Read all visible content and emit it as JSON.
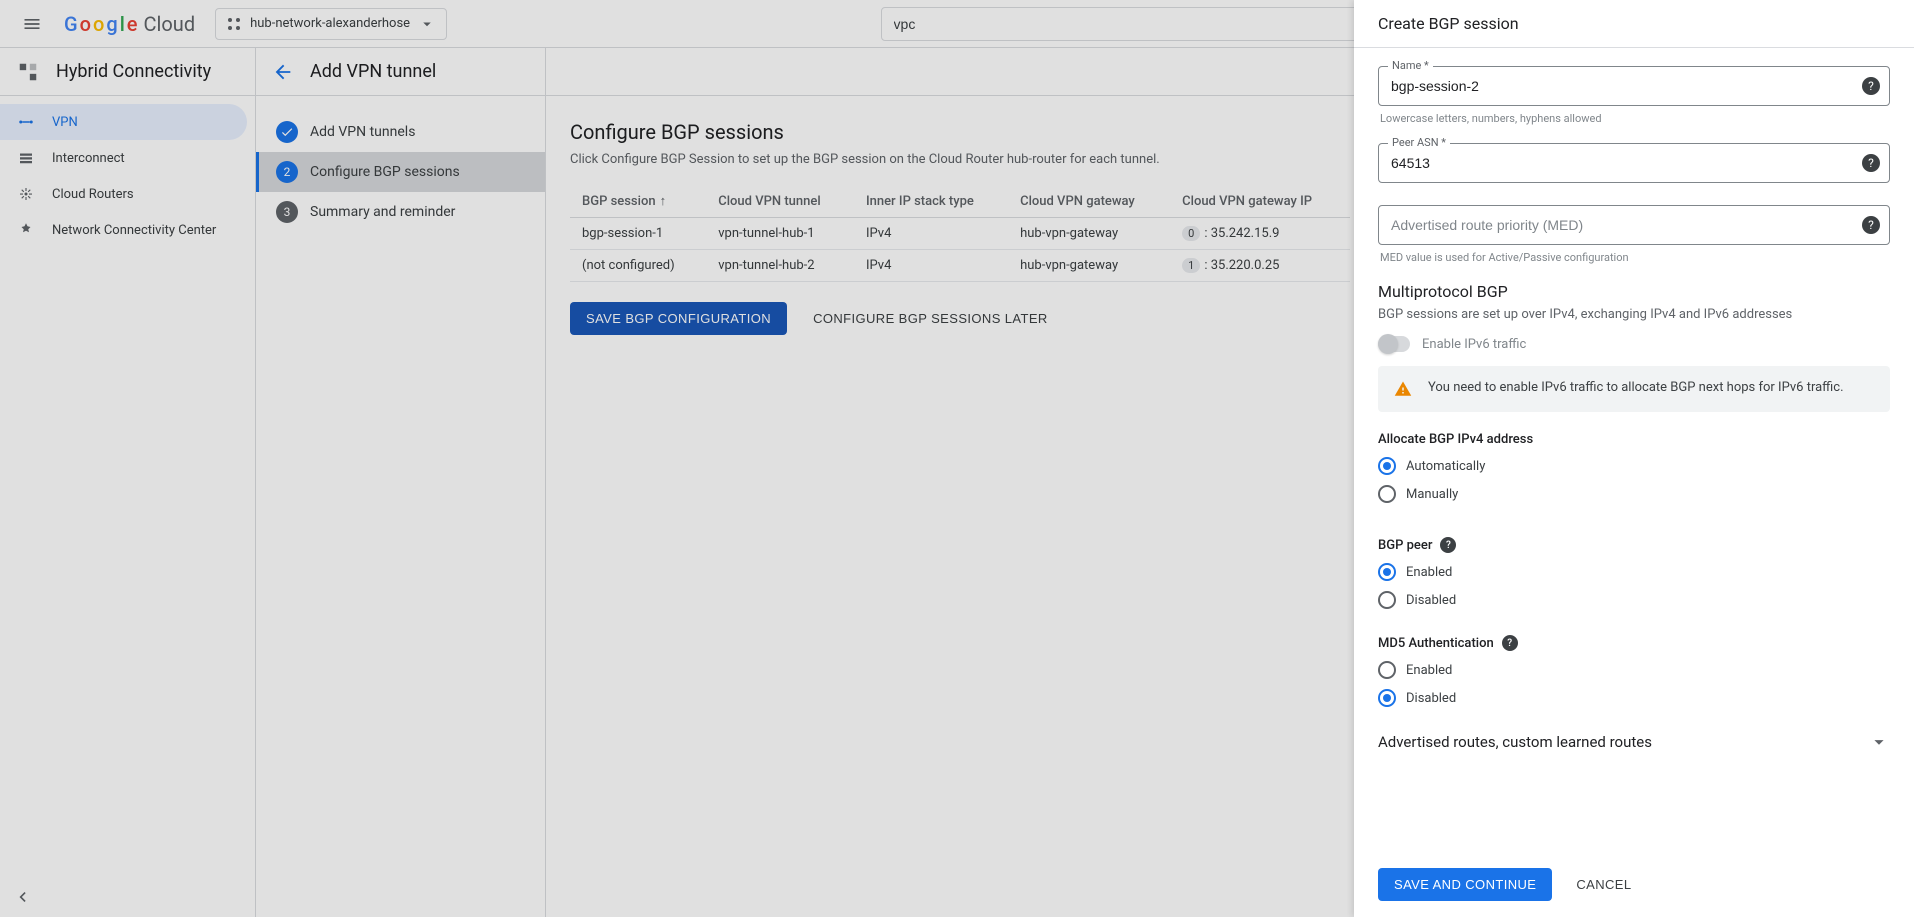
{
  "header": {
    "logo_text": "Google Cloud",
    "project_name": "hub-network-alexanderhose",
    "search_value": "vpc"
  },
  "leftnav": {
    "title": "Hybrid Connectivity",
    "items": [
      {
        "label": "VPN",
        "selected": true
      },
      {
        "label": "Interconnect"
      },
      {
        "label": "Cloud Routers"
      },
      {
        "label": "Network Connectivity Center"
      }
    ]
  },
  "main": {
    "page_title": "Add VPN tunnel",
    "steps": [
      {
        "label": "Add VPN tunnels",
        "state": "done"
      },
      {
        "label": "Configure BGP sessions",
        "state": "active"
      },
      {
        "label": "Summary and reminder",
        "state": "pending"
      }
    ],
    "content_title": "Configure BGP sessions",
    "content_subtitle": "Click Configure BGP Session to set up the BGP session on the Cloud Router hub-router for each tunnel.",
    "table": {
      "columns": [
        "BGP session",
        "Cloud VPN tunnel",
        "Inner IP stack type",
        "Cloud VPN gateway",
        "Cloud VPN gateway IP"
      ],
      "rows": [
        {
          "bgp": "bgp-session-1",
          "tunnel": "vpn-tunnel-hub-1",
          "stack": "IPv4",
          "gw": "hub-vpn-gateway",
          "idx": "0",
          "ip": "35.242.15.9"
        },
        {
          "bgp": "(not configured)",
          "tunnel": "vpn-tunnel-hub-2",
          "stack": "IPv4",
          "gw": "hub-vpn-gateway",
          "idx": "1",
          "ip": "35.220.0.25"
        }
      ]
    },
    "save_btn": "SAVE BGP CONFIGURATION",
    "later_btn": "CONFIGURE BGP SESSIONS LATER"
  },
  "panel": {
    "title": "Create BGP session",
    "name_label": "Name *",
    "name_value": "bgp-session-2",
    "name_helper": "Lowercase letters, numbers, hyphens allowed",
    "asn_label": "Peer ASN *",
    "asn_value": "64513",
    "med_placeholder": "Advertised route priority (MED)",
    "med_helper": "MED value is used for Active/Passive configuration",
    "mp_title": "Multiprotocol BGP",
    "mp_sub": "BGP sessions are set up over IPv4, exchanging IPv4 and IPv6 addresses",
    "ipv6_toggle_label": "Enable IPv6 traffic",
    "ipv6_warning": "You need to enable IPv6 traffic to allocate BGP next hops for IPv6 traffic.",
    "alloc_title": "Allocate BGP IPv4 address",
    "alloc_options": [
      "Automatically",
      "Manually"
    ],
    "alloc_selected": 0,
    "peer_title": "BGP peer",
    "peer_options": [
      "Enabled",
      "Disabled"
    ],
    "peer_selected": 0,
    "md5_title": "MD5 Authentication",
    "md5_options": [
      "Enabled",
      "Disabled"
    ],
    "md5_selected": 1,
    "expand_label": "Advertised routes, custom learned routes",
    "save_btn": "SAVE AND CONTINUE",
    "cancel_btn": "CANCEL"
  }
}
